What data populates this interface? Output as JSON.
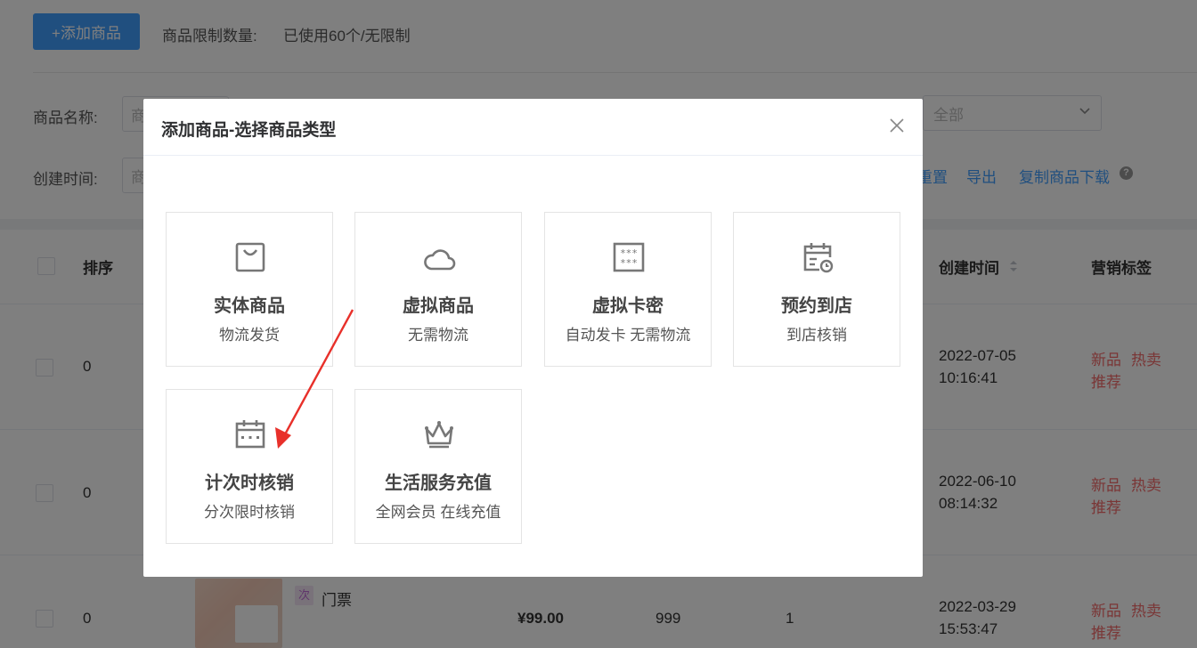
{
  "toolbar": {
    "add_button": "+添加商品",
    "limit_label": "商品限制数量:",
    "limit_value": "已使用60个/无限制"
  },
  "filters": {
    "name_label": "商品名称:",
    "name_placeholder": "商",
    "time_label": "创建时间:",
    "time_placeholder": "商",
    "status_select": "全部",
    "reset_link": "重置",
    "export_link": "导出",
    "copy_download_link": "复制商品下载"
  },
  "table": {
    "headers": {
      "sort": "排序",
      "created": "创建时间",
      "marketing": "营销标签"
    },
    "rows": [
      {
        "sort": "0",
        "date": "2022-07-05",
        "time": "10:16:41",
        "tags": [
          "新品",
          "热卖",
          "推荐"
        ]
      },
      {
        "sort": "0",
        "date": "2022-06-10",
        "time": "08:14:32",
        "tags": [
          "新品",
          "热卖",
          "推荐"
        ]
      },
      {
        "sort": "0",
        "badge": "次",
        "name": "门票",
        "price": "¥99.00",
        "stock": "999",
        "sales": "1",
        "date": "2022-03-29",
        "time": "15:53:47",
        "tags": [
          "新品",
          "热卖",
          "推荐"
        ]
      }
    ]
  },
  "dialog": {
    "title": "添加商品-选择商品类型",
    "cards": [
      {
        "title": "实体商品",
        "subtitle": "物流发货",
        "icon": "shopping-bag-icon"
      },
      {
        "title": "虚拟商品",
        "subtitle": "无需物流",
        "icon": "cloud-icon"
      },
      {
        "title": "虚拟卡密",
        "subtitle": "自动发卡 无需物流",
        "icon": "card-code-icon"
      },
      {
        "title": "预约到店",
        "subtitle": "到店核销",
        "icon": "calendar-clock-icon"
      },
      {
        "title": "计次时核销",
        "subtitle": "分次限时核销",
        "icon": "calendar-icon"
      },
      {
        "title": "生活服务充值",
        "subtitle": "全网会员 在线充值",
        "icon": "crown-icon"
      }
    ]
  },
  "colors": {
    "primary": "#409eff",
    "tag_red": "#f56c6c",
    "arrow_red": "#e8302a"
  }
}
